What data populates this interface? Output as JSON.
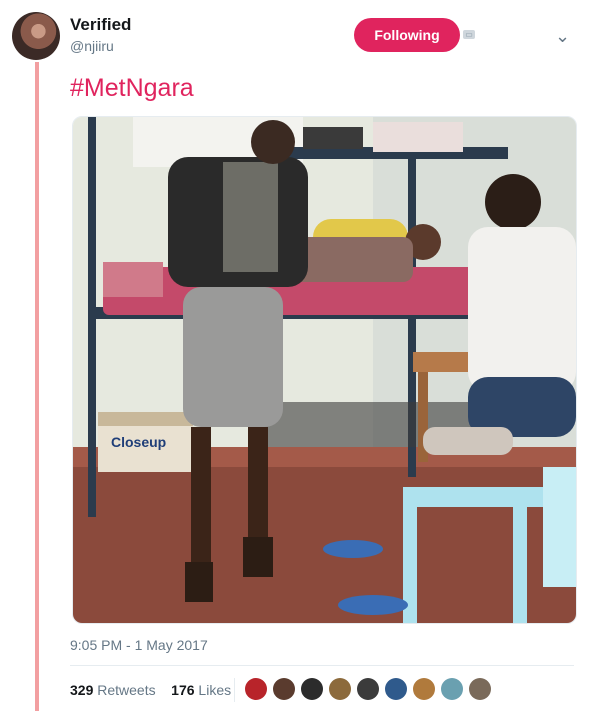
{
  "user": {
    "name": "Verified",
    "handle": "@njiiru",
    "follow_label": "Following"
  },
  "tweet": {
    "hashtag": "#MetNgara",
    "timestamp": "9:05 PM - 1 May 2017"
  },
  "photo": {
    "box_label": "Closeup"
  },
  "stats": {
    "retweets_count": "329",
    "retweets_label": "Retweets",
    "likes_count": "176",
    "likes_label": "Likes"
  },
  "likers": [
    {
      "icon": "liker-avatar-1",
      "color": "#b8242a"
    },
    {
      "icon": "liker-avatar-2",
      "color": "#5a3b2e"
    },
    {
      "icon": "liker-avatar-3",
      "color": "#2c2c2c"
    },
    {
      "icon": "liker-avatar-4",
      "color": "#8c6a3c"
    },
    {
      "icon": "liker-avatar-5",
      "color": "#3b3b3b"
    },
    {
      "icon": "liker-avatar-6",
      "color": "#2f5a8c"
    },
    {
      "icon": "liker-avatar-7",
      "color": "#b07a3c"
    },
    {
      "icon": "liker-avatar-8",
      "color": "#6aa0b0"
    },
    {
      "icon": "liker-avatar-9",
      "color": "#7a6a5a"
    }
  ],
  "colors": {
    "accent": "#e0245e",
    "thread_line": "#f29fa1",
    "muted": "#657786"
  }
}
